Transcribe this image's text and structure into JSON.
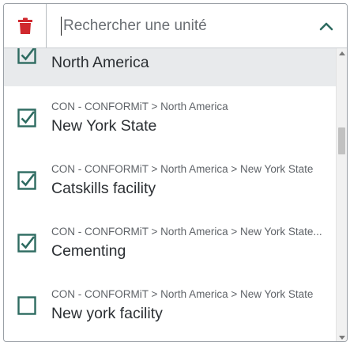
{
  "search": {
    "placeholder": "Rechercher une unité",
    "value": ""
  },
  "icons": {
    "clear": "trash-icon",
    "toggle": "chevron-up-icon",
    "checked": "checkbox-checked-icon",
    "unchecked": "checkbox-unchecked-icon"
  },
  "colors": {
    "trash": "#d0282e",
    "accent": "#2e6b61",
    "selected_row": "#e8eaec"
  },
  "list": {
    "items": [
      {
        "path": "",
        "name": "North America",
        "checked": true,
        "highlighted": true
      },
      {
        "path": "CON - CONFORMiT > North America",
        "name": "New York State",
        "checked": true,
        "highlighted": false
      },
      {
        "path": "CON - CONFORMiT > North America > New York State",
        "name": "Catskills facility",
        "checked": true,
        "highlighted": false
      },
      {
        "path": "CON - CONFORMiT > North America > New York State...",
        "name": "Cementing",
        "checked": true,
        "highlighted": false
      },
      {
        "path": "CON - CONFORMiT > North America > New York State",
        "name": "New york facility",
        "checked": false,
        "highlighted": false
      }
    ]
  }
}
